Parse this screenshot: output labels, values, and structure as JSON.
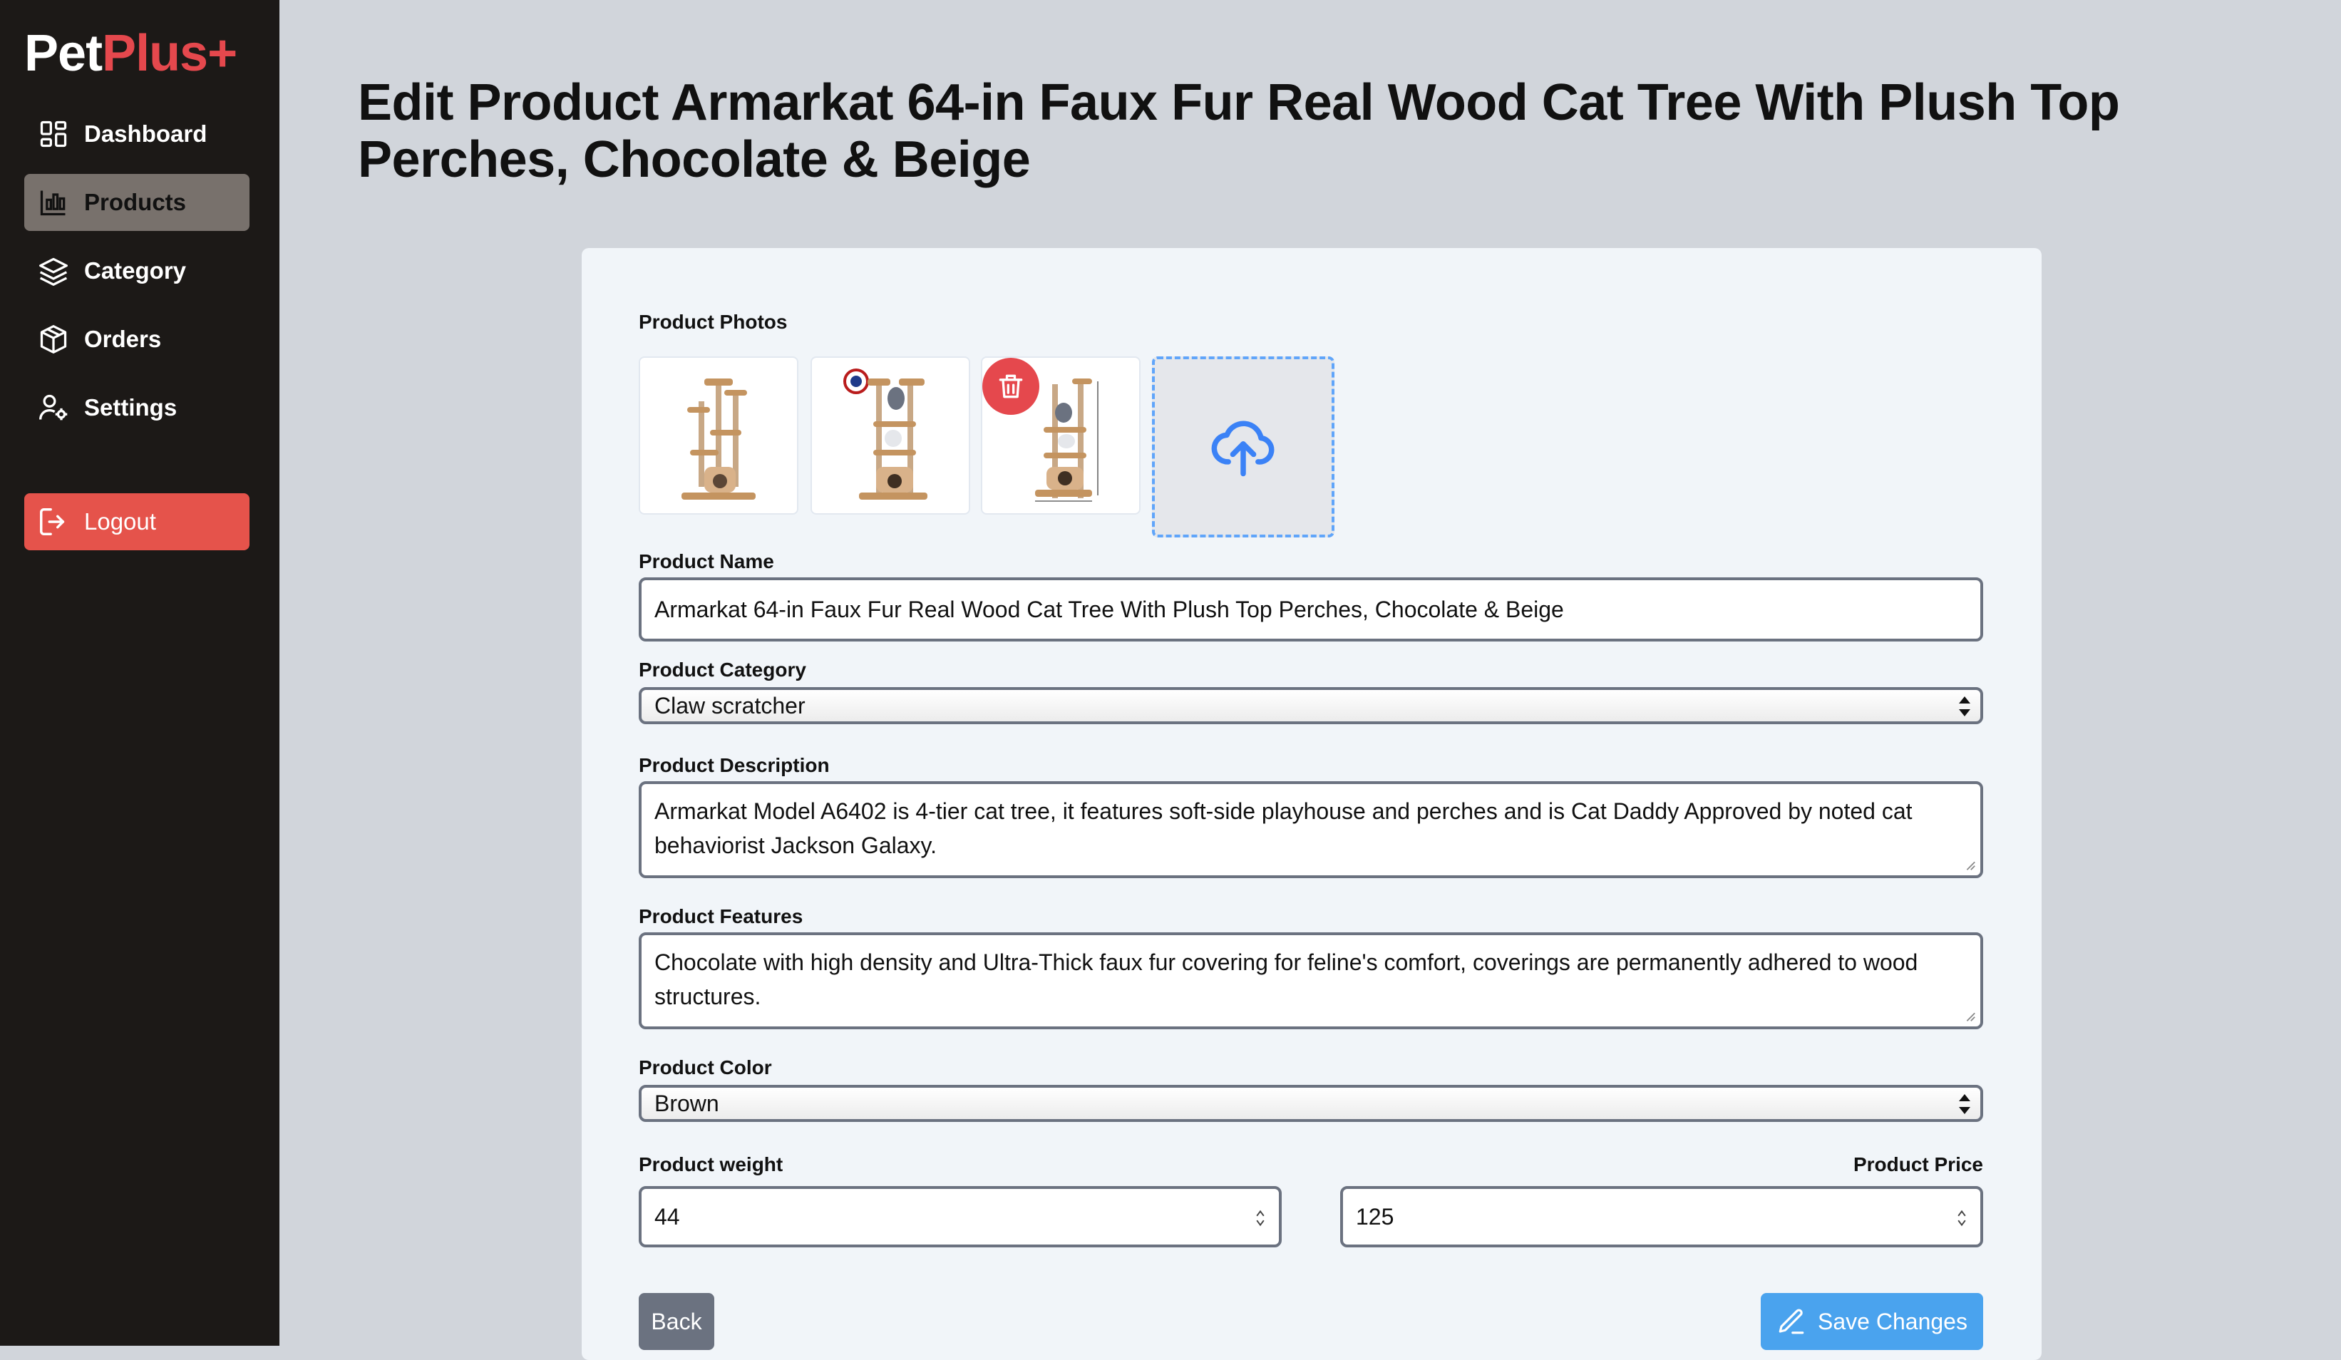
{
  "app": {
    "logo_part1": "Pet",
    "logo_part2": "Plus+",
    "brand_color": "#e5484d"
  },
  "sidebar": {
    "items": [
      {
        "label": "Dashboard",
        "icon": "dashboard-grid-icon",
        "active": false
      },
      {
        "label": "Products",
        "icon": "chart-bars-icon",
        "active": true
      },
      {
        "label": "Category",
        "icon": "layers-icon",
        "active": false
      },
      {
        "label": "Orders",
        "icon": "box-icon",
        "active": false
      },
      {
        "label": "Settings",
        "icon": "user-settings-icon",
        "active": false
      }
    ],
    "logout_label": "Logout"
  },
  "page": {
    "title": "Edit Product Armarkat 64-in Faux Fur Real Wood Cat Tree With Plush Top Perches, Chocolate & Beige"
  },
  "form": {
    "photos_label": "Product Photos",
    "name_label": "Product Name",
    "name_value": "Armarkat 64-in Faux Fur Real Wood Cat Tree With Plush Top Perches, Chocolate & Beige",
    "category_label": "Product Category",
    "category_value": "Claw scratcher",
    "description_label": "Product Description",
    "description_value": "Armarkat Model A6402 is 4-tier cat tree, it features soft-side playhouse and perches and is Cat Daddy Approved by noted cat behaviorist Jackson Galaxy.",
    "features_label": "Product Features",
    "features_value": "Chocolate with high density and Ultra-Thick faux fur covering for feline's comfort, coverings are permanently adhered to wood structures.",
    "color_label": "Product Color",
    "color_value": "Brown",
    "weight_label": "Product weight",
    "weight_value": "44",
    "price_label": "Product Price",
    "price_value": "125",
    "back_label": "Back",
    "save_label": "Save Changes"
  }
}
